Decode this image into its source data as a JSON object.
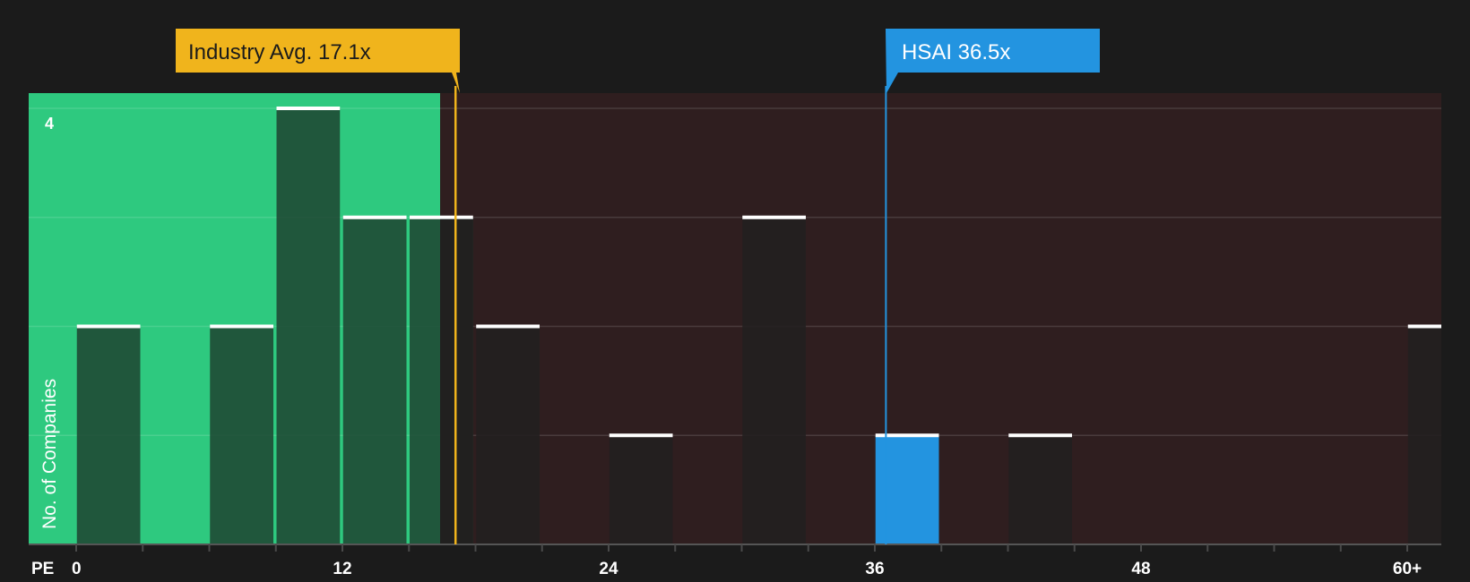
{
  "chart_data": {
    "type": "bar",
    "xlabel": "PE",
    "ylabel": "No. of Companies",
    "x_tick_labels": [
      "0",
      "12",
      "24",
      "36",
      "48",
      "60+"
    ],
    "x_tick_values": [
      0,
      12,
      24,
      36,
      48,
      60
    ],
    "y_tick_labels": [
      "4"
    ],
    "ylim": [
      0,
      4
    ],
    "xlim": [
      -2.2,
      61.6
    ],
    "bin_width": 3,
    "bins": [
      {
        "x": 0,
        "count": 2
      },
      {
        "x": 6,
        "count": 2
      },
      {
        "x": 9,
        "count": 4
      },
      {
        "x": 12,
        "count": 3
      },
      {
        "x": 15,
        "count": 3
      },
      {
        "x": 18,
        "count": 2
      },
      {
        "x": 24,
        "count": 1
      },
      {
        "x": 30,
        "count": 3
      },
      {
        "x": 36,
        "count": 1,
        "highlight": true
      },
      {
        "x": 42,
        "count": 1
      },
      {
        "x": 60,
        "count": 2
      }
    ],
    "industry_avg": {
      "value": 17.1,
      "label": "Industry Avg. 17.1x"
    },
    "company": {
      "value": 36.5,
      "label": "HSAI 36.5x"
    },
    "colors": {
      "background": "#1b1b1b",
      "undervalued_zone": "#2ec97f",
      "overvalued_zone": "#2f1e1f",
      "bar_in_green": "#1f4a35",
      "bar_in_red": "#221f1f",
      "highlight_bar": "#2394e0",
      "industry_callout": "#f0b41c",
      "company_callout": "#2394e0"
    }
  }
}
